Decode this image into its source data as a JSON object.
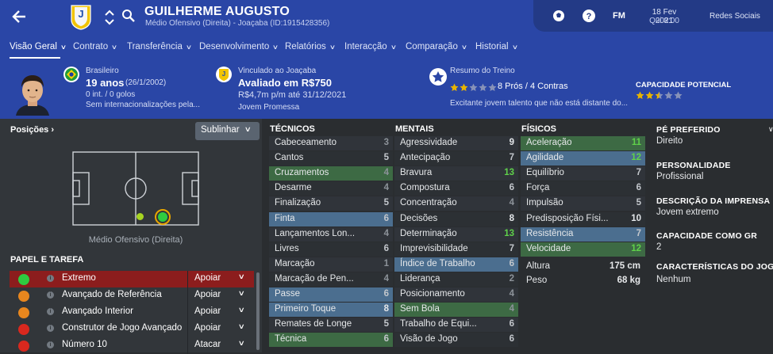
{
  "header": {
    "player_name": "GUILHERME AUGUSTO",
    "subtitle": "Médio Ofensivo (Direita) - Joaçaba (ID:1915428356)",
    "club_crest_text": "JAC",
    "fm_label": "FM",
    "date_line1": "18 Fev 2021",
    "date_line2": "Qui 8:00",
    "social_label": "Redes Sociais",
    "colors": {
      "header_bg": "#2a46a6",
      "header_right_bg": "#233a86"
    }
  },
  "tabs": [
    {
      "label": "Visão Geral",
      "active": true
    },
    {
      "label": "Contrato"
    },
    {
      "label": "Transferência"
    },
    {
      "label": "Desenvolvimento"
    },
    {
      "label": "Relatórios"
    },
    {
      "label": "Interacção"
    },
    {
      "label": "Comparação"
    },
    {
      "label": "Historial"
    }
  ],
  "info": {
    "nationality": "Brasileiro",
    "age": "19 anos",
    "dob": "(26/1/2002)",
    "caps": "0 int. / 0 golos",
    "intl_note": "Sem internacionalizações pela...",
    "contract_label": "Vinculado ao Joaçaba",
    "value": "Avaliado em R$750",
    "wage": "R$4,7m p/m até 31/12/2021",
    "status": "Jovem Promessa",
    "training_title": "Resumo do Treino",
    "training_rating": 2,
    "pros_cons": "8 Prós / 4 Contras",
    "training_desc": "Excitante jovem talento que não está distante do...",
    "potential_label": "CAPACIDADE POTENCIAL",
    "potential_rating": 2.5
  },
  "positions": {
    "title": "Posições",
    "highlight_button": "Sublinhar",
    "position_label": "Médio Ofensivo (Direita)"
  },
  "roles": {
    "title": "PAPEL E TAREFA",
    "items": [
      {
        "name": "Extremo",
        "duty": "Apoiar",
        "dot": "#2ecc40",
        "selected": true
      },
      {
        "name": "Avançado de Referência",
        "duty": "Apoiar",
        "dot": "#e8871e"
      },
      {
        "name": "Avançado Interior",
        "duty": "Apoiar",
        "dot": "#e8871e"
      },
      {
        "name": "Construtor de Jogo Avançado",
        "duty": "Apoiar",
        "dot": "#d9281e"
      },
      {
        "name": "Número 10",
        "duty": "Atacar",
        "dot": "#d9281e"
      }
    ]
  },
  "attributes": {
    "tecnicos_title": "TÉCNICOS",
    "mentais_title": "MENTAIS",
    "fisicos_title": "FÍSICOS",
    "tecnicos": [
      {
        "name": "Cabeceamento",
        "value": 3
      },
      {
        "name": "Cantos",
        "value": 5
      },
      {
        "name": "Cruzamentos",
        "value": 4,
        "hl": "green"
      },
      {
        "name": "Desarme",
        "value": 4
      },
      {
        "name": "Finalização",
        "value": 5
      },
      {
        "name": "Finta",
        "value": 6,
        "hl": "blue"
      },
      {
        "name": "Lançamentos Lon...",
        "value": 4
      },
      {
        "name": "Livres",
        "value": 6
      },
      {
        "name": "Marcação",
        "value": 1
      },
      {
        "name": "Marcação de Pen...",
        "value": 4
      },
      {
        "name": "Passe",
        "value": 6,
        "hl": "blue"
      },
      {
        "name": "Primeiro Toque",
        "value": 8,
        "hl": "blue"
      },
      {
        "name": "Remates de Longe",
        "value": 5
      },
      {
        "name": "Técnica",
        "value": 6,
        "hl": "green"
      }
    ],
    "mentais": [
      {
        "name": "Agressividade",
        "value": 9
      },
      {
        "name": "Antecipação",
        "value": 7
      },
      {
        "name": "Bravura",
        "value": 13
      },
      {
        "name": "Compostura",
        "value": 6
      },
      {
        "name": "Concentração",
        "value": 4
      },
      {
        "name": "Decisões",
        "value": 8
      },
      {
        "name": "Determinação",
        "value": 13
      },
      {
        "name": "Imprevisibilidade",
        "value": 7
      },
      {
        "name": "Índice de Trabalho",
        "value": 6,
        "hl": "blue"
      },
      {
        "name": "Liderança",
        "value": 2
      },
      {
        "name": "Posicionamento",
        "value": 4
      },
      {
        "name": "Sem Bola",
        "value": 4,
        "hl": "green"
      },
      {
        "name": "Trabalho de Equi...",
        "value": 6
      },
      {
        "name": "Visão de Jogo",
        "value": 6
      }
    ],
    "fisicos": [
      {
        "name": "Aceleração",
        "value": 11,
        "hl": "green"
      },
      {
        "name": "Agilidade",
        "value": 12,
        "hl": "blue"
      },
      {
        "name": "Equilíbrio",
        "value": 7
      },
      {
        "name": "Força",
        "value": 6
      },
      {
        "name": "Impulsão",
        "value": 5
      },
      {
        "name": "Predisposição Físi...",
        "value": 10
      },
      {
        "name": "Resistência",
        "value": 7,
        "hl": "blue"
      },
      {
        "name": "Velocidade",
        "value": 12,
        "hl": "green"
      }
    ],
    "height_label": "Altura",
    "height_value": "175 cm",
    "weight_label": "Peso",
    "weight_value": "68 kg"
  },
  "right": {
    "foot_label": "PÉ PREFERIDO",
    "foot_value": "Direito",
    "pers_label": "PERSONALIDADE",
    "pers_value": "Profissional",
    "press_label": "DESCRIÇÃO DA IMPRENSA",
    "press_value": "Jovem extremo",
    "gk_label": "CAPACIDADE COMO GR",
    "gk_value": "2",
    "traits_label": "CARACTERÍSTICAS DO JOGA...",
    "traits_value": "Nenhum"
  }
}
